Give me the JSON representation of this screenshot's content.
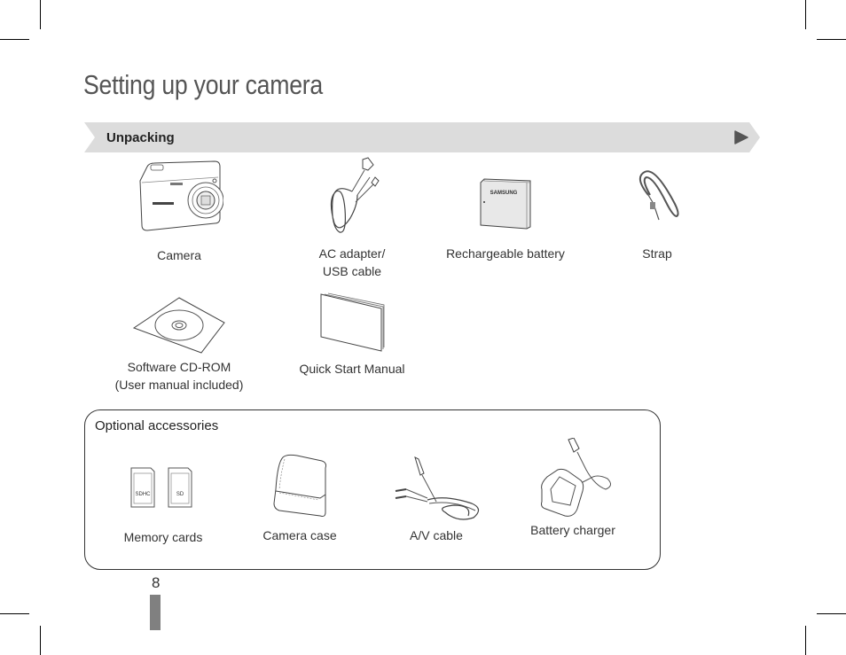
{
  "page": {
    "title": "Setting up your camera",
    "page_number": "8"
  },
  "section": {
    "label": "Unpacking",
    "arrow_icon": "play-triangle-icon",
    "banner_color": "#dcdcdc",
    "arrow_color": "#555555"
  },
  "unpacking_items": [
    {
      "label": "Camera",
      "icon": "camera-icon"
    },
    {
      "label": "AC adapter/\nUSB cable",
      "icon": "ac-adapter-cable-icon"
    },
    {
      "label": "Rechargeable battery",
      "icon": "battery-icon",
      "brand": "SAMSUNG"
    },
    {
      "label": "Strap",
      "icon": "strap-icon"
    },
    {
      "label": "Software CD-ROM\n(User manual included)",
      "icon": "cd-rom-icon"
    },
    {
      "label": "Quick Start Manual",
      "icon": "manual-book-icon"
    }
  ],
  "optional": {
    "title": "Optional accessories",
    "items": [
      {
        "label": "Memory cards",
        "icon": "memory-cards-icon",
        "card_labels": [
          "SDHC",
          "SD"
        ]
      },
      {
        "label": "Camera case",
        "icon": "camera-case-icon"
      },
      {
        "label": "A/V cable",
        "icon": "av-cable-icon"
      },
      {
        "label": "Battery charger",
        "icon": "battery-charger-icon"
      }
    ]
  }
}
